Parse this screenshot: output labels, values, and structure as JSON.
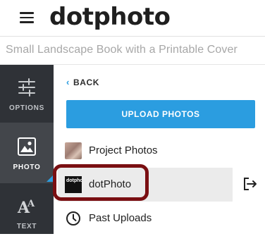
{
  "header": {
    "logo_text": "dotphoto"
  },
  "project": {
    "title": "Small Landscape Book with a Printable Cover"
  },
  "sidebar": {
    "items": [
      {
        "label": "OPTIONS",
        "icon": "sliders-icon"
      },
      {
        "label": "PHOTO",
        "icon": "image-icon",
        "active": true
      },
      {
        "label": "TEXT",
        "icon": "text-aa-icon"
      }
    ]
  },
  "panel": {
    "back_label": "BACK",
    "upload_label": "UPLOAD PHOTOS",
    "sources": [
      {
        "label": "Project Photos",
        "icon": "project-thumbnail"
      },
      {
        "label": "dotPhoto",
        "icon": "dotphoto-thumbnail",
        "selected": true
      },
      {
        "label": "Past Uploads",
        "icon": "clock-icon"
      }
    ],
    "dotphoto_thumb_text": "dotphoto"
  },
  "colors": {
    "accent": "#2b9de0",
    "sidebar_bg": "#2f3237",
    "sidebar_active_bg": "#43464b",
    "highlight_border": "#7a0f12"
  }
}
